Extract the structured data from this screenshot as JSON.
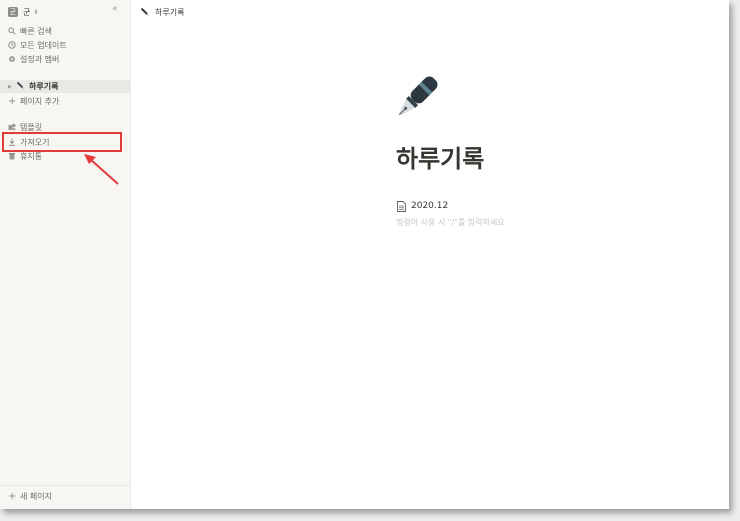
{
  "sidebar": {
    "workspace_avatar": "군",
    "workspace_name": "군",
    "top_items": [
      {
        "label": "빠른 검색",
        "icon": "search-icon"
      },
      {
        "label": "모든 업데이트",
        "icon": "clock-icon"
      },
      {
        "label": "설정과 멤버",
        "icon": "gear-icon"
      }
    ],
    "pages": [
      {
        "label": "하루기록",
        "icon": "pen-icon"
      }
    ],
    "add_page": "페이지 추가",
    "tools": [
      {
        "label": "템플릿",
        "icon": "template-icon"
      },
      {
        "label": "가져오기",
        "icon": "import-icon"
      },
      {
        "label": "휴지통",
        "icon": "trash-icon"
      }
    ],
    "new_page": "새 페이지"
  },
  "breadcrumb": {
    "label": "하루기록",
    "icon": "pen-icon"
  },
  "page": {
    "title": "하루기록",
    "subpage": "2020.12",
    "placeholder": "명령어 사용 시 \"/\"를 입력하세요"
  },
  "colors": {
    "highlight": "#e33a3a",
    "sidebar_bg": "#f7f6f3",
    "text": "#37352f"
  }
}
